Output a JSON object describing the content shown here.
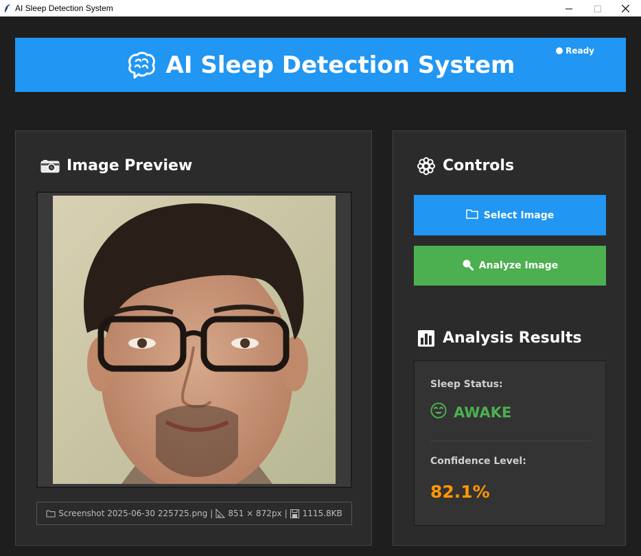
{
  "window": {
    "title": "AI Sleep Detection System",
    "app_icon": "feather-icon",
    "controls": [
      "minimize-icon",
      "maximize-icon",
      "close-icon"
    ]
  },
  "header": {
    "icon": "brain-icon",
    "title": "AI Sleep Detection System",
    "status": "Ready",
    "background": "#2196f3"
  },
  "preview": {
    "icon": "camera-icon",
    "title": "Image Preview",
    "file_name": "Screenshot 2025-06-30 225725.png",
    "dimensions": "851 × 872px",
    "file_size": "1115.8KB",
    "sep": "|"
  },
  "controls": {
    "icon": "gear-icon",
    "title": "Controls",
    "select_label": "Select Image",
    "select_color": "#2196f3",
    "analyze_label": "Analyze Image",
    "analyze_color": "#4caf50"
  },
  "results": {
    "icon": "bar-chart-icon",
    "title": "Analysis Results",
    "sleep_status_label": "Sleep Status:",
    "sleep_status_value": "AWAKE",
    "sleep_status_color": "#4caf50",
    "confidence_label": "Confidence Level:",
    "confidence_value": "82.1%",
    "confidence_color": "#ff9800"
  }
}
